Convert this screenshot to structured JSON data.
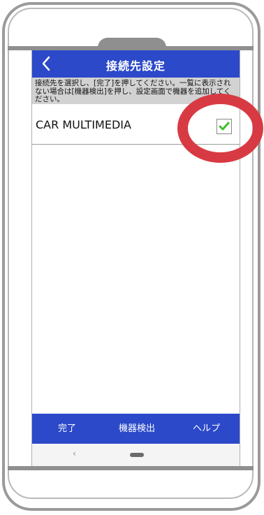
{
  "header": {
    "title": "接続先設定"
  },
  "instruction": {
    "text": "接続先を選択し、[完了]を押してください。一覧に表示されない場合は[機器検出]を押し、設定画面で機器を追加してください。"
  },
  "devices": [
    {
      "name": "CAR MULTIMEDIA",
      "checked": true
    }
  ],
  "toolbar": {
    "done_label": "完了",
    "detect_label": "機器検出",
    "help_label": "ヘルプ"
  },
  "navbar": {
    "back_label": "‹"
  },
  "colors": {
    "header_bg": "#2b49c9",
    "instruction_bg": "#d2d2d2",
    "check": "#3fbf2b",
    "highlight": "#d83a43"
  }
}
